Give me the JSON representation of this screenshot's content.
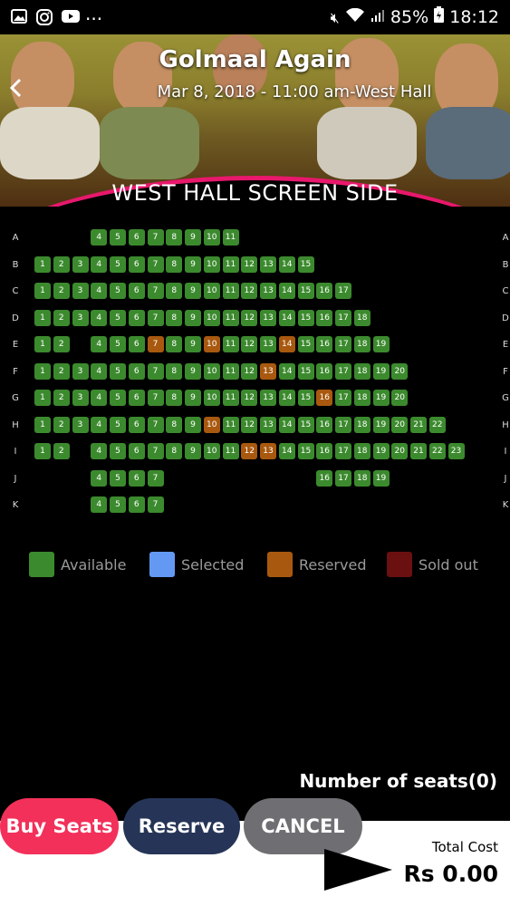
{
  "status_bar": {
    "battery": "85%",
    "time": "18:12",
    "more": "..."
  },
  "movie": {
    "title": "Golmaal Again",
    "subtitle": "Mar 8, 2018 - 11:00 am-West Hall"
  },
  "screen_label": "WEST HALL SCREEN SIDE",
  "rows": [
    "A",
    "B",
    "C",
    "D",
    "E",
    "F",
    "G",
    "H",
    "I",
    "J",
    "K"
  ],
  "seating": [
    {
      "row": "A",
      "seats": [
        {
          "n": 4
        },
        {
          "n": 5
        },
        {
          "n": 6
        },
        {
          "n": 7
        },
        {
          "n": 8
        },
        {
          "n": 9
        },
        {
          "n": 10
        },
        {
          "n": 11
        }
      ]
    },
    {
      "row": "B",
      "seats": [
        {
          "n": 1
        },
        {
          "n": 2
        },
        {
          "n": 3
        },
        {
          "n": 4
        },
        {
          "n": 5
        },
        {
          "n": 6
        },
        {
          "n": 7
        },
        {
          "n": 8
        },
        {
          "n": 9
        },
        {
          "n": 10
        },
        {
          "n": 11
        },
        {
          "n": 12
        },
        {
          "n": 13
        },
        {
          "n": 14
        },
        {
          "n": 15
        }
      ]
    },
    {
      "row": "C",
      "seats": [
        {
          "n": 1
        },
        {
          "n": 2
        },
        {
          "n": 3
        },
        {
          "n": 4
        },
        {
          "n": 5
        },
        {
          "n": 6
        },
        {
          "n": 7
        },
        {
          "n": 8
        },
        {
          "n": 9
        },
        {
          "n": 10
        },
        {
          "n": 11
        },
        {
          "n": 12
        },
        {
          "n": 13
        },
        {
          "n": 14
        },
        {
          "n": 15
        },
        {
          "n": 16
        },
        {
          "n": 17
        }
      ]
    },
    {
      "row": "D",
      "seats": [
        {
          "n": 1
        },
        {
          "n": 2
        },
        {
          "n": 3
        },
        {
          "n": 4
        },
        {
          "n": 5
        },
        {
          "n": 6
        },
        {
          "n": 7
        },
        {
          "n": 8
        },
        {
          "n": 9
        },
        {
          "n": 10
        },
        {
          "n": 11
        },
        {
          "n": 12
        },
        {
          "n": 13
        },
        {
          "n": 14
        },
        {
          "n": 15
        },
        {
          "n": 16
        },
        {
          "n": 17
        },
        {
          "n": 18
        }
      ]
    },
    {
      "row": "E",
      "seats": [
        {
          "n": 1
        },
        {
          "n": 2
        },
        {
          "n": 4
        },
        {
          "n": 5
        },
        {
          "n": 6
        },
        {
          "n": 7,
          "s": "reserved"
        },
        {
          "n": 8
        },
        {
          "n": 9
        },
        {
          "n": 10,
          "s": "reserved"
        },
        {
          "n": 11
        },
        {
          "n": 12
        },
        {
          "n": 13
        },
        {
          "n": 14,
          "s": "reserved"
        },
        {
          "n": 15
        },
        {
          "n": 16
        },
        {
          "n": 17
        },
        {
          "n": 18
        },
        {
          "n": 19
        }
      ]
    },
    {
      "row": "F",
      "seats": [
        {
          "n": 1
        },
        {
          "n": 2
        },
        {
          "n": 3
        },
        {
          "n": 4
        },
        {
          "n": 5
        },
        {
          "n": 6
        },
        {
          "n": 7
        },
        {
          "n": 8
        },
        {
          "n": 9
        },
        {
          "n": 10
        },
        {
          "n": 11
        },
        {
          "n": 12
        },
        {
          "n": 13,
          "s": "reserved"
        },
        {
          "n": 14
        },
        {
          "n": 15
        },
        {
          "n": 16
        },
        {
          "n": 17
        },
        {
          "n": 18
        },
        {
          "n": 19
        },
        {
          "n": 20
        }
      ]
    },
    {
      "row": "G",
      "seats": [
        {
          "n": 1
        },
        {
          "n": 2
        },
        {
          "n": 3
        },
        {
          "n": 4
        },
        {
          "n": 5
        },
        {
          "n": 6
        },
        {
          "n": 7
        },
        {
          "n": 8
        },
        {
          "n": 9
        },
        {
          "n": 10
        },
        {
          "n": 11
        },
        {
          "n": 12
        },
        {
          "n": 13
        },
        {
          "n": 14
        },
        {
          "n": 15
        },
        {
          "n": 16,
          "s": "reserved"
        },
        {
          "n": 17
        },
        {
          "n": 18
        },
        {
          "n": 19
        },
        {
          "n": 20
        }
      ]
    },
    {
      "row": "H",
      "seats": [
        {
          "n": 1
        },
        {
          "n": 2
        },
        {
          "n": 3
        },
        {
          "n": 4
        },
        {
          "n": 5
        },
        {
          "n": 6
        },
        {
          "n": 7
        },
        {
          "n": 8
        },
        {
          "n": 9
        },
        {
          "n": 10,
          "s": "reserved"
        },
        {
          "n": 11
        },
        {
          "n": 12
        },
        {
          "n": 13
        },
        {
          "n": 14
        },
        {
          "n": 15
        },
        {
          "n": 16
        },
        {
          "n": 17
        },
        {
          "n": 18
        },
        {
          "n": 19
        },
        {
          "n": 20
        },
        {
          "n": 21
        },
        {
          "n": 22
        }
      ]
    },
    {
      "row": "I",
      "seats": [
        {
          "n": 1
        },
        {
          "n": 2
        },
        {
          "n": 4
        },
        {
          "n": 5
        },
        {
          "n": 6
        },
        {
          "n": 7
        },
        {
          "n": 8
        },
        {
          "n": 9
        },
        {
          "n": 10
        },
        {
          "n": 11
        },
        {
          "n": 12,
          "s": "reserved"
        },
        {
          "n": 13,
          "s": "reserved"
        },
        {
          "n": 14
        },
        {
          "n": 15
        },
        {
          "n": 16
        },
        {
          "n": 17
        },
        {
          "n": 18
        },
        {
          "n": 19
        },
        {
          "n": 20
        },
        {
          "n": 21
        },
        {
          "n": 22
        },
        {
          "n": 23
        }
      ]
    },
    {
      "row": "J",
      "seats": [
        {
          "n": 4
        },
        {
          "n": 5
        },
        {
          "n": 6
        },
        {
          "n": 7
        },
        {
          "n": 16
        },
        {
          "n": 17
        },
        {
          "n": 18
        },
        {
          "n": 19
        }
      ]
    },
    {
      "row": "K",
      "seats": [
        {
          "n": 4
        },
        {
          "n": 5
        },
        {
          "n": 6
        },
        {
          "n": 7
        }
      ]
    }
  ],
  "legend": [
    {
      "label": "Available",
      "color": "#3c8a2e"
    },
    {
      "label": "Selected",
      "color": "#6499f3"
    },
    {
      "label": "Reserved",
      "color": "#a9590f"
    },
    {
      "label": "Sold out",
      "color": "#6b1010"
    }
  ],
  "number_of_seats": "Number of seats(0)",
  "buttons": {
    "buy": {
      "label": "Buy Seats",
      "color": "#f2305a"
    },
    "reserve": {
      "label": "Reserve",
      "color": "#263557"
    },
    "cancel": {
      "label": "CANCEL",
      "color": "#6f6f73"
    }
  },
  "total": {
    "label": "Total Cost",
    "value": "Rs 0.00"
  },
  "colors": {
    "available": "#3c8a2e",
    "reserved": "#a9590f",
    "accent": "#e8186c"
  }
}
